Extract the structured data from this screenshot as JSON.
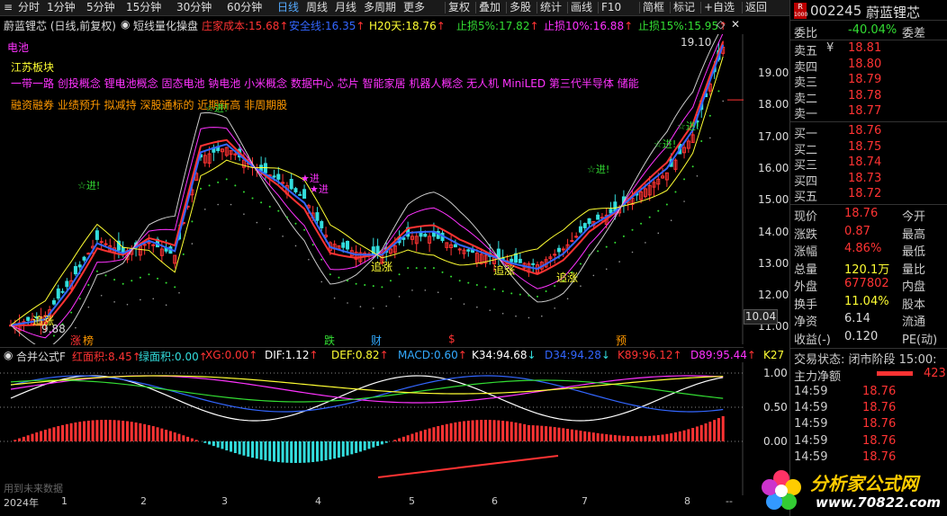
{
  "toolbar": {
    "left_items": [
      "分时",
      "1分钟",
      "5分钟",
      "15分钟",
      "30分钟",
      "60分钟",
      "日线",
      "周线",
      "月线",
      "多周期",
      "更多"
    ],
    "active": "日线",
    "right_items": [
      "复权",
      "叠加",
      "多股",
      "统计",
      "画线",
      "F10",
      "简框",
      "标记",
      "+自选",
      "返回"
    ]
  },
  "stock_header": {
    "badge_top": "R",
    "badge_bottom": "1000",
    "code": "002245",
    "name": "蔚蓝锂芯"
  },
  "title_row": {
    "title": "蔚蓝锂芯 (日线,前复权)",
    "formula": "短线量化操盘",
    "items": [
      {
        "label": "庄家成本:",
        "value": "15.68",
        "color": "#ff3333"
      },
      {
        "label": "安全线:",
        "value": "16.35",
        "color": "#3366ff"
      },
      {
        "label": "H20天:",
        "value": "18.76",
        "color": "#ffff33"
      },
      {
        "label": "止损5%:",
        "value": "17.82",
        "color": "#33dd33"
      },
      {
        "label": "止损10%:",
        "value": "16.88",
        "color": "#ff33ff"
      },
      {
        "label": "止损15%:",
        "value": "15.95",
        "color": "#33dd33"
      }
    ]
  },
  "main_chart": {
    "labels": {
      "sector_battery": "电池",
      "sector_jiangsu": "江苏板块",
      "concepts_1": "一带一路 创投概念 锂电池概念 固态电池 钠电池 小米概念 数据中心 芯片 智能家居 机器人概念 无人机 MiniLED 第三代半导体 储能",
      "concepts_2": "融资融券 业绩预升 拟减持 深股通标的 近期新高 非周期股",
      "high_mark": "19.10",
      "low_mark": "9.88",
      "last_price_tag": "10.04",
      "signals": [
        "☆进!",
        "☆进!",
        "★进",
        "★进",
        "☆进!",
        "☆进!",
        "☆进!"
      ],
      "zhui_zhang": [
        "追涨",
        "追涨",
        "追涨",
        "追涨"
      ]
    },
    "y_axis": [
      "19.00",
      "18.00",
      "17.00",
      "16.00",
      "15.00",
      "14.00",
      "13.00",
      "12.00",
      "11.00"
    ],
    "event_marks": [
      {
        "text": "涨",
        "color": "#ff3333"
      },
      {
        "text": "榜",
        "color": "#ff9900"
      },
      {
        "text": "跌",
        "color": "#33dd33"
      },
      {
        "text": "财",
        "color": "#33aaff"
      },
      {
        "text": "$",
        "color": "#ff3333"
      },
      {
        "text": "预",
        "color": "#ff9900"
      }
    ]
  },
  "sub_chart": {
    "name": "合并公式F",
    "items": [
      {
        "label": "红面积:",
        "value": "8.45",
        "color": "#ff3333"
      },
      {
        "label": "绿面积:",
        "value": "0.00",
        "color": "#33dddd"
      },
      {
        "label": "XG:",
        "value": "0.00",
        "color": "#ff3333"
      },
      {
        "label": "DIF:",
        "value": "1.12",
        "color": "#ffffff"
      },
      {
        "label": "DEF:",
        "value": "0.82",
        "color": "#ffff33"
      },
      {
        "label": "MACD:",
        "value": "0.60",
        "color": "#33aaff"
      },
      {
        "label": "K34:",
        "value": "94.68",
        "color": "#ffffff"
      },
      {
        "label": "D34:",
        "value": "94.28",
        "color": "#3366ff"
      },
      {
        "label": "K89:",
        "value": "96.12",
        "color": "#ff3333"
      },
      {
        "label": "D89:",
        "value": "95.44",
        "color": "#ff33ff"
      },
      {
        "label": "K27",
        "value": "",
        "color": "#ffff33"
      }
    ],
    "y_axis": [
      "1.00",
      "0.50",
      "0.00"
    ],
    "hint": "用到未来数据"
  },
  "x_axis": {
    "labels": [
      "2024年",
      "1",
      "2",
      "3",
      "4",
      "5",
      "6",
      "7",
      "8"
    ],
    "corner": "--"
  },
  "right_panel": {
    "wei_bi": {
      "label": "委比",
      "value": "-40.04%",
      "extra": "委差"
    },
    "sell": [
      {
        "label": "卖五",
        "mark": "¥",
        "price": "18.81"
      },
      {
        "label": "卖四",
        "mark": "",
        "price": "18.80"
      },
      {
        "label": "卖三",
        "mark": "",
        "price": "18.79"
      },
      {
        "label": "卖二",
        "mark": "",
        "price": "18.78"
      },
      {
        "label": "卖一",
        "mark": "",
        "price": "18.77"
      }
    ],
    "buy": [
      {
        "label": "买一",
        "price": "18.76"
      },
      {
        "label": "买二",
        "price": "18.75"
      },
      {
        "label": "买三",
        "price": "18.74"
      },
      {
        "label": "买四",
        "price": "18.73"
      },
      {
        "label": "买五",
        "price": "18.72"
      }
    ],
    "stats": [
      {
        "l1": "现价",
        "v1": "18.76",
        "v1c": "red",
        "l2": "今开"
      },
      {
        "l1": "涨跌",
        "v1": "0.87",
        "v1c": "red",
        "l2": "最高"
      },
      {
        "l1": "涨幅",
        "v1": "4.86%",
        "v1c": "red",
        "l2": "最低"
      },
      {
        "l1": "总量",
        "v1": "120.1万",
        "v1c": "yellow",
        "l2": "量比"
      },
      {
        "l1": "外盘",
        "v1": "677802",
        "v1c": "red",
        "l2": "内盘"
      },
      {
        "l1": "换手",
        "v1": "11.04%",
        "v1c": "yellow",
        "l2": "股本"
      },
      {
        "l1": "净资",
        "v1": "6.14",
        "v1c": "white",
        "l2": "流通"
      },
      {
        "l1": "收益(-)",
        "v1": "0.120",
        "v1c": "white",
        "l2": "PE(动)"
      }
    ],
    "trade_status": "交易状态: 闭市阶段 15:00:",
    "main_net": {
      "label": "主力净额",
      "value": "423"
    },
    "ticks": [
      {
        "time": "14:59",
        "price": "18.76"
      },
      {
        "time": "14:59",
        "price": "18.76"
      },
      {
        "time": "14:59",
        "price": "18.76"
      },
      {
        "time": "14:59",
        "price": "18.76"
      },
      {
        "time": "14:59",
        "price": "18.76"
      }
    ]
  },
  "watermark": {
    "title": "分析家公式网",
    "url": "www.70822.com"
  }
}
